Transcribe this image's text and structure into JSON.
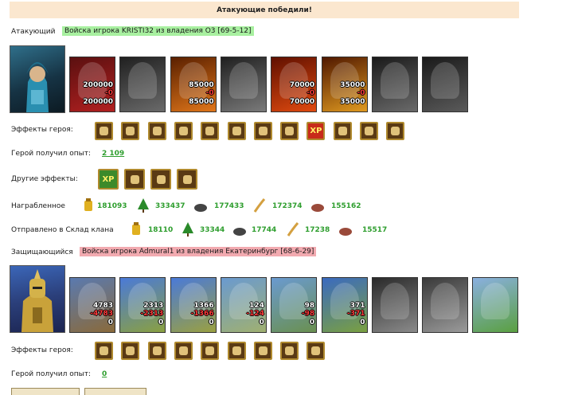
{
  "banner": "Атакующие победили!",
  "attacker": {
    "label": "Атакующий",
    "army": "Войска игрока KRISTI32 из владения O3 [69-5-12]",
    "units": [
      {
        "name": "red-dragon",
        "c1": "200000",
        "c2": "-0",
        "c3": "200000"
      },
      {
        "name": "dark-knight",
        "c1": "",
        "c2": "",
        "c3": ""
      },
      {
        "name": "fire-beast",
        "c1": "85000",
        "c2": "-0",
        "c3": "85000"
      },
      {
        "name": "gargoyle",
        "c1": "",
        "c2": "",
        "c3": ""
      },
      {
        "name": "flame-demon",
        "c1": "70000",
        "c2": "-0",
        "c3": "70000"
      },
      {
        "name": "fire-elemental",
        "c1": "35000",
        "c2": "-0",
        "c3": "35000"
      },
      {
        "name": "dark-lord",
        "c1": "",
        "c2": "",
        "c3": ""
      },
      {
        "name": "wraith",
        "c1": "",
        "c2": "",
        "c3": ""
      }
    ],
    "effects_label": "Эффекты героя:",
    "exp_label": "Герой получил опыт:",
    "exp_value": "2 109",
    "other_label": "Другие эффекты:",
    "loot_label": "Награбленное",
    "loot": [
      "181093",
      "333437",
      "177433",
      "172374",
      "155162"
    ],
    "sent_label": "Отправлено в Склад клана",
    "sent": [
      "18110",
      "33344",
      "17744",
      "17238",
      "15517"
    ]
  },
  "defender": {
    "label": "Защищающийся",
    "army": "Войска игрока Admural1 из владения Екатеринбург [68-6-29]",
    "units": [
      {
        "name": "archer-tower",
        "c1": "4783",
        "c2": "-4783",
        "c3": "0"
      },
      {
        "name": "crusader",
        "c1": "2313",
        "c2": "-2313",
        "c3": "0"
      },
      {
        "name": "paladin",
        "c1": "1366",
        "c2": "-1366",
        "c3": "0"
      },
      {
        "name": "griffin",
        "c1": "124",
        "c2": "-124",
        "c3": "0"
      },
      {
        "name": "cavalier",
        "c1": "98",
        "c2": "-98",
        "c3": "0"
      },
      {
        "name": "angel",
        "c1": "371",
        "c2": "-371",
        "c3": "0"
      },
      {
        "name": "stone-guard",
        "c1": "",
        "c2": "",
        "c3": ""
      },
      {
        "name": "stone-dragon",
        "c1": "",
        "c2": "",
        "c3": ""
      },
      {
        "name": "castle",
        "c1": "",
        "c2": "",
        "c3": ""
      }
    ],
    "effects_label": "Эффекты героя:",
    "exp_label": "Герой получил опыт:",
    "exp_value": "0"
  },
  "xp_text": "XP",
  "colors": {
    "banner": "#fbe7cf",
    "attacker_tag": "#a8f0a0",
    "defender_tag": "#f2aab0",
    "value_green": "#2e9e2e",
    "loss_red": "#ff3a3a"
  }
}
